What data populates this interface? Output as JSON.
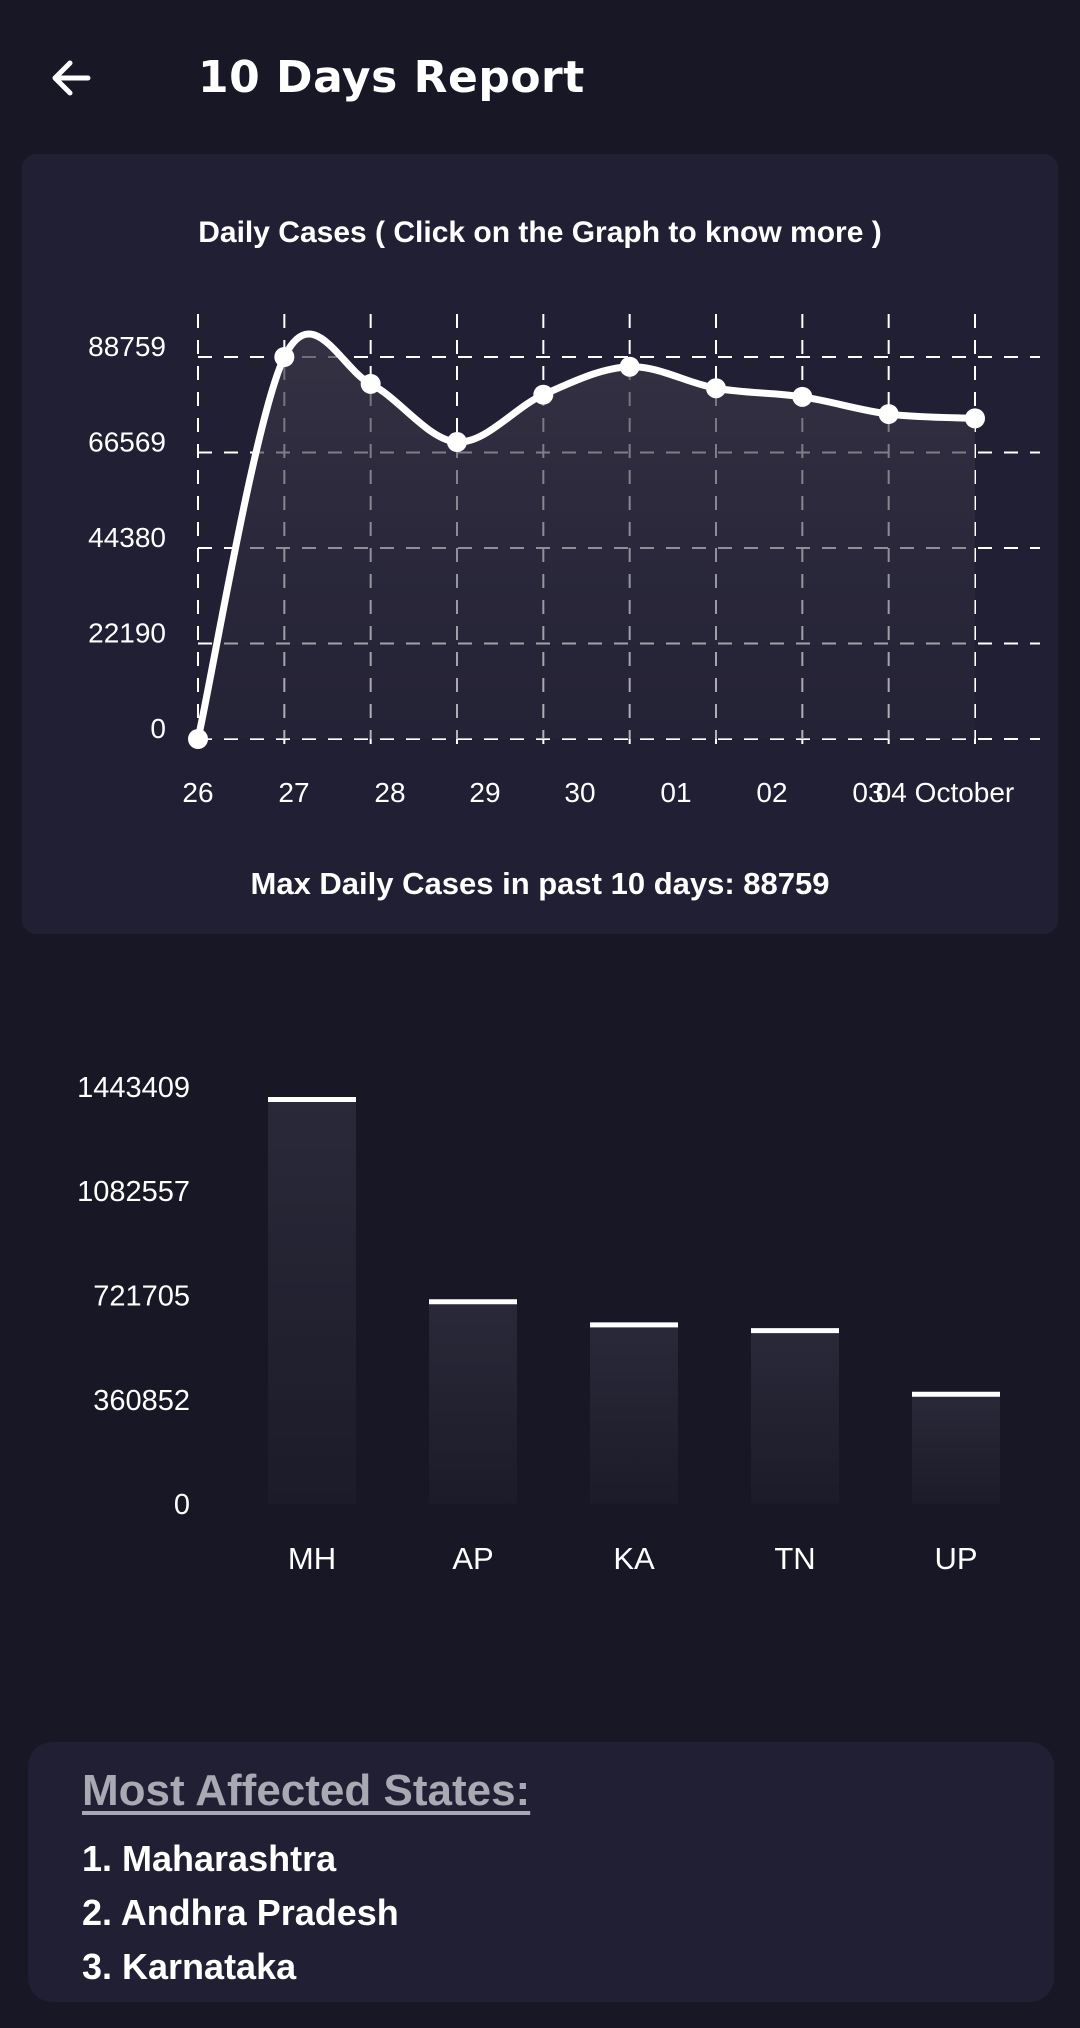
{
  "app_bar": {
    "title": "10 Days Report",
    "back_icon": "arrow-left-icon"
  },
  "line_card": {
    "title": "Daily Cases ( Click on the Graph to know more )",
    "footer": "Max Daily Cases in past 10 days: 88759"
  },
  "states_card": {
    "heading": "Most Affected States:",
    "items": [
      "1. Maharashtra",
      "2. Andhra Pradesh",
      "3. Karnataka"
    ]
  },
  "colors": {
    "background": "#181726",
    "card": "#211f33",
    "line": "#ffffff",
    "bar_top": "#2a2939",
    "bar_bottom": "#1c1b29"
  },
  "chart_data": [
    {
      "type": "line",
      "title": "Daily Cases ( Click on the Graph to know more )",
      "x": [
        "26",
        "27",
        "28",
        "29",
        "30",
        "01",
        "02",
        "03",
        "04 October"
      ],
      "series": [
        {
          "values": [
            0,
            88759,
            82500,
            69000,
            80000,
            86500,
            81500,
            79500,
            75500,
            74500
          ]
        }
      ],
      "ylim": [
        0,
        88759
      ],
      "yticks": [
        "0",
        "22190",
        "44380",
        "66569",
        "88759"
      ],
      "grid": true,
      "xlabel": "",
      "ylabel": ""
    },
    {
      "type": "bar",
      "categories": [
        "MH",
        "AP",
        "KA",
        "TN",
        "UP"
      ],
      "values": [
        1400000,
        700000,
        620000,
        600000,
        380000
      ],
      "ylim": [
        0,
        1443409
      ],
      "yticks": [
        "0",
        "360852",
        "721705",
        "1082557",
        "1443409"
      ],
      "xlabel": "",
      "ylabel": ""
    }
  ]
}
